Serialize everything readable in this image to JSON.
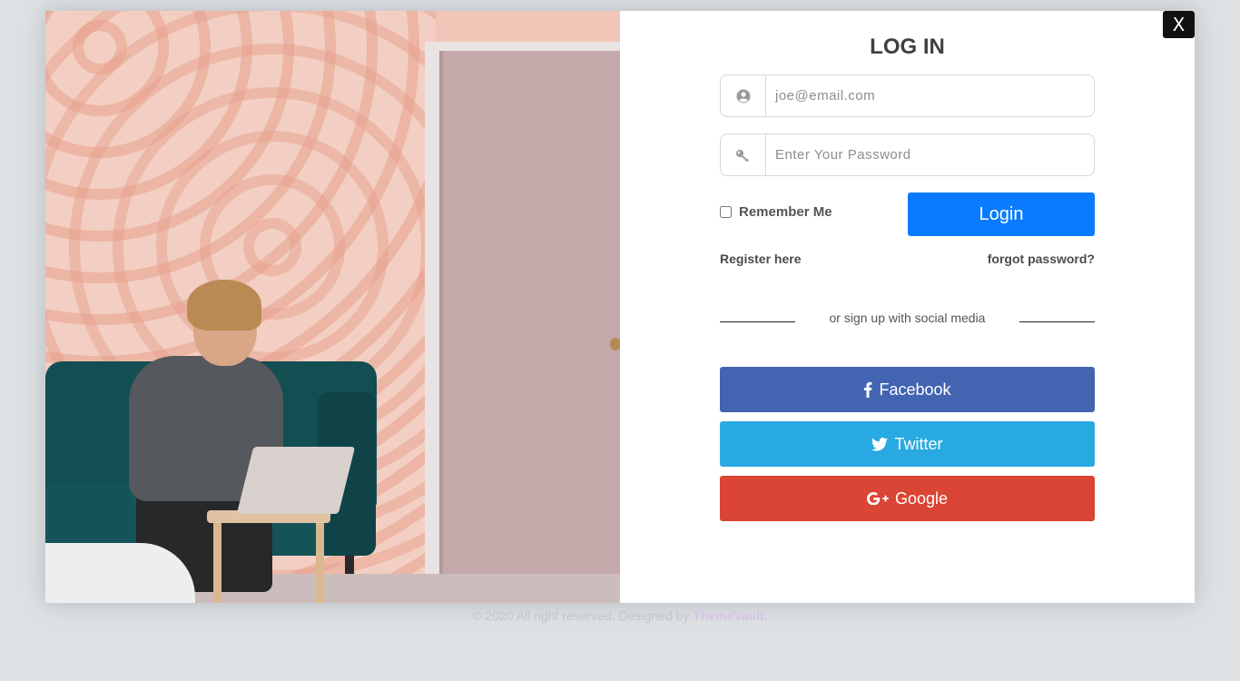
{
  "modal": {
    "close_label": "X",
    "title": "LOG IN",
    "email": {
      "placeholder": "joe@email.com"
    },
    "password": {
      "placeholder": "Enter Your Password"
    },
    "remember_label": "Remember Me",
    "login_label": "Login",
    "register_label": "Register here",
    "forgot_label": "forgot password?",
    "divider_text": "or sign up with social media",
    "social": {
      "facebook": {
        "label": "Facebook",
        "color": "#4264b1",
        "icon": "facebook-icon"
      },
      "twitter": {
        "label": "Twitter",
        "color": "#29a9e1",
        "icon": "twitter-icon"
      },
      "google": {
        "label": "Google",
        "color": "#db4535",
        "icon": "google-plus-icon"
      }
    }
  },
  "footer": {
    "text": "© 2020 All right reserved. Designed by",
    "brand": "ThemeVault."
  },
  "colors": {
    "accent": "#0a7bff",
    "background": "#dde1e4"
  }
}
